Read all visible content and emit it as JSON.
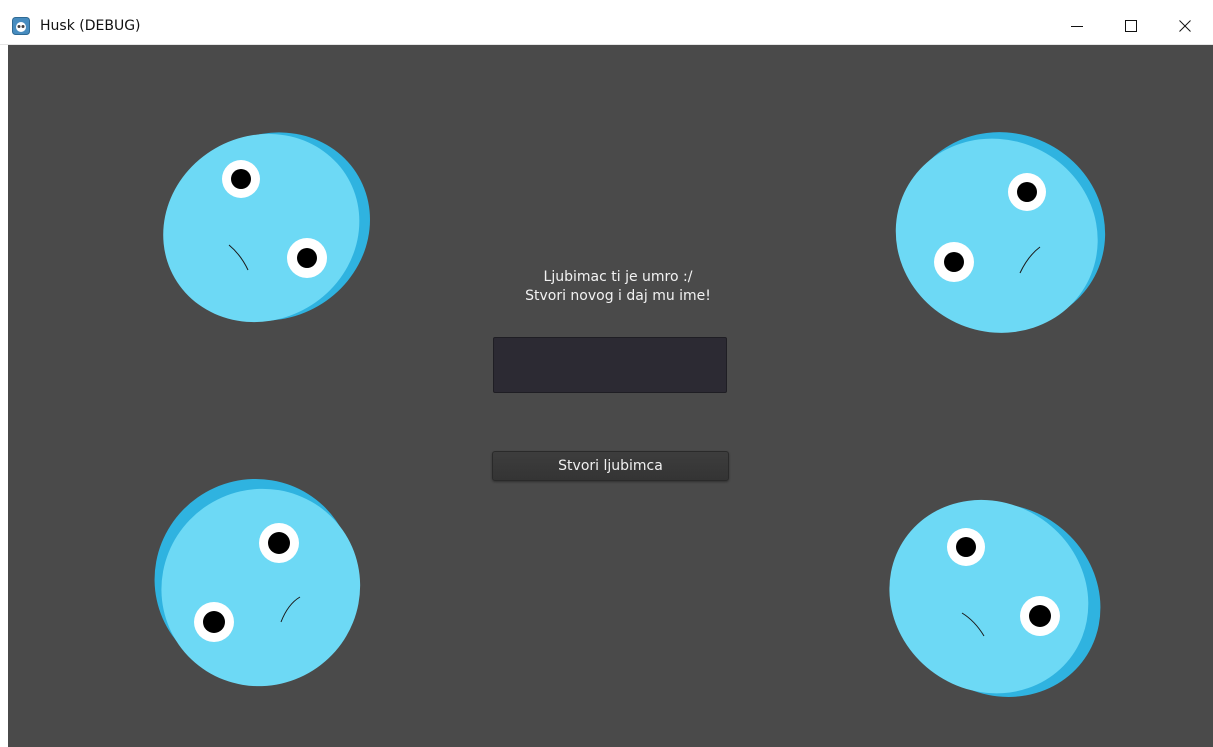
{
  "window": {
    "title": "Husk (DEBUG)",
    "icon": "godot-app-icon",
    "controls": {
      "minimize_icon": "minimize-icon",
      "maximize_icon": "maximize-icon",
      "close_icon": "close-icon"
    }
  },
  "game": {
    "background_color": "#4a4a4a",
    "creature_color": "#6dd9f5",
    "creature_shadow_color": "#2fb3e0",
    "prompt": {
      "line1": "Ljubimac ti je umro :/",
      "line2": "Stvori novog i daj mu ime!"
    },
    "name_input": {
      "value": "",
      "placeholder": ""
    },
    "create_button_label": "Stvori ljubimca",
    "creatures": [
      {
        "name": "sad-pet-top-left"
      },
      {
        "name": "sad-pet-top-right"
      },
      {
        "name": "sad-pet-bottom-left"
      },
      {
        "name": "sad-pet-bottom-right"
      }
    ]
  }
}
